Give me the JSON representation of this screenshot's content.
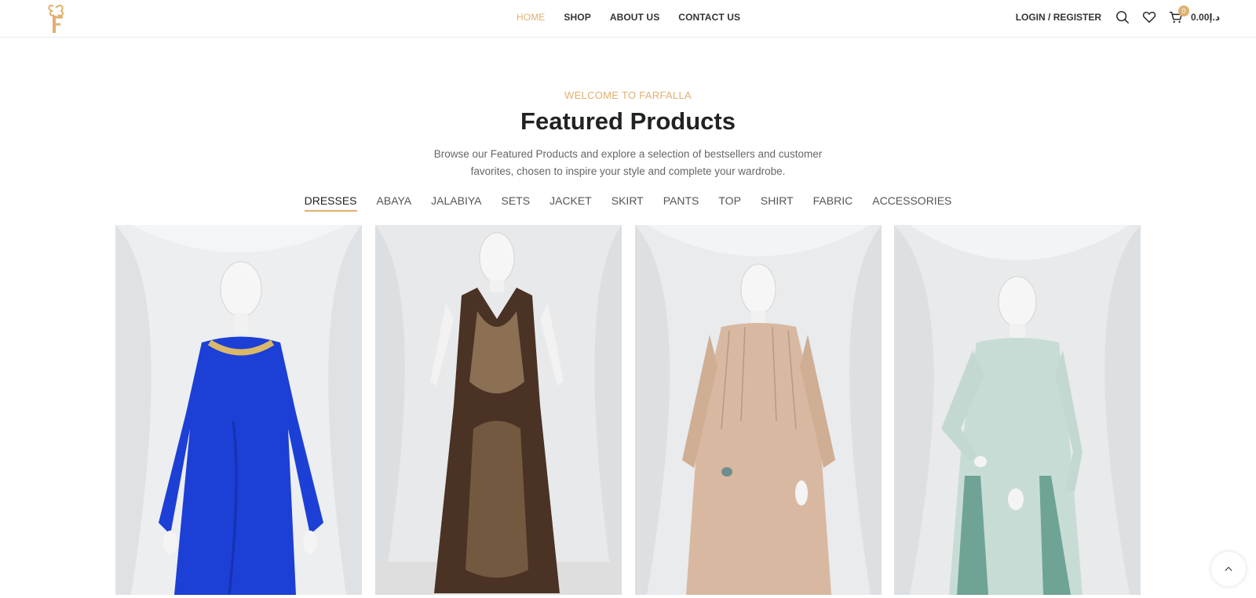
{
  "header": {
    "nav": [
      {
        "label": "HOME",
        "active": true
      },
      {
        "label": "SHOP"
      },
      {
        "label": "ABOUT US"
      },
      {
        "label": "CONTACT US"
      }
    ],
    "login_label": "LOGIN / REGISTER",
    "cart_count": "0",
    "cart_total": "0.00د.إ"
  },
  "intro": {
    "kicker": "WELCOME TO FARFALLA",
    "title": "Featured Products",
    "description": "Browse our Featured Products and explore a selection of bestsellers and customer favorites, chosen to inspire your style and complete your wardrobe."
  },
  "tabs": [
    {
      "label": "DRESSES",
      "active": true
    },
    {
      "label": "ABAYA"
    },
    {
      "label": "JALABIYA"
    },
    {
      "label": "SETS"
    },
    {
      "label": "JACKET"
    },
    {
      "label": "SKIRT"
    },
    {
      "label": "PANTS"
    },
    {
      "label": "TOP"
    },
    {
      "label": "SHIRT"
    },
    {
      "label": "FABRIC"
    },
    {
      "label": "ACCESSORIES"
    }
  ],
  "colors": {
    "accent": "#e0b070",
    "dress_blue": "#1c3fd6",
    "dress_brown": "#4a3224",
    "dress_nude": "#d8b8a0",
    "dress_mint": "#b9d3cc"
  },
  "icons": [
    "logo-icon",
    "search-icon",
    "heart-icon",
    "cart-icon",
    "chevron-up-icon"
  ]
}
